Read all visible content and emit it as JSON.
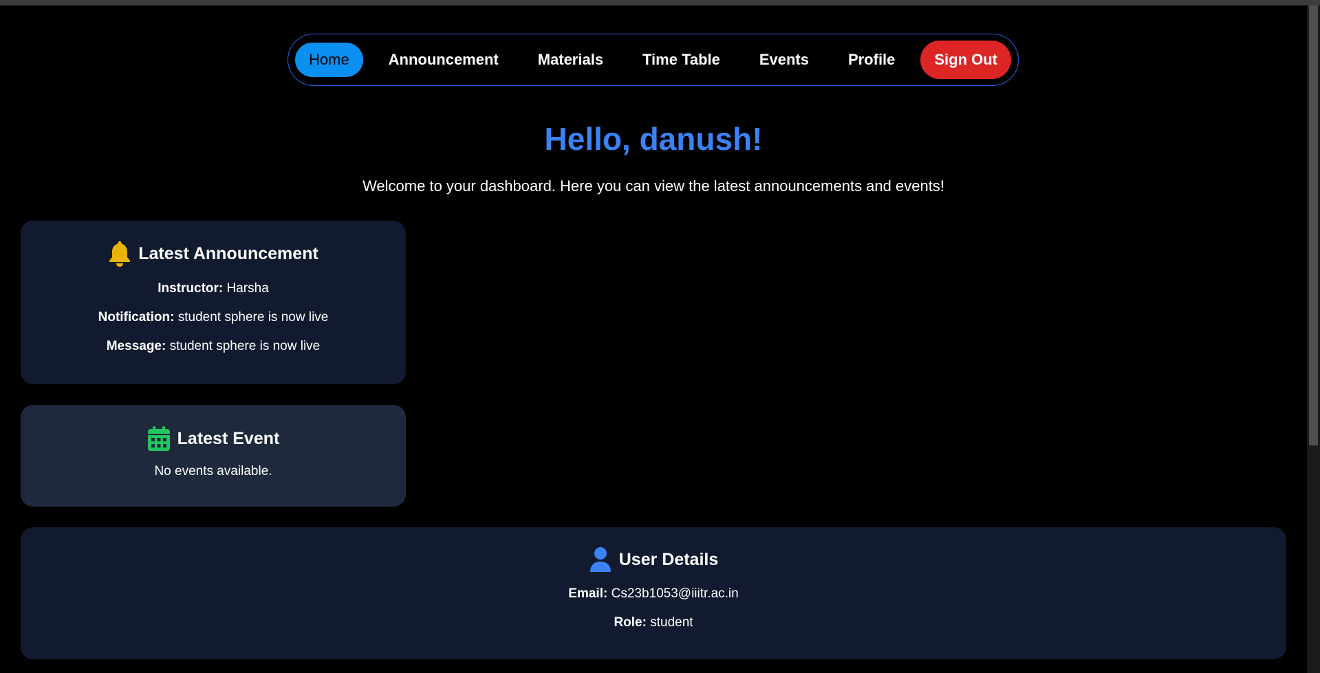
{
  "nav": {
    "items": [
      {
        "label": "Home",
        "active": true
      },
      {
        "label": "Announcement",
        "active": false
      },
      {
        "label": "Materials",
        "active": false
      },
      {
        "label": "Time Table",
        "active": false
      },
      {
        "label": "Events",
        "active": false
      },
      {
        "label": "Profile",
        "active": false
      }
    ],
    "signout_label": "Sign Out"
  },
  "greeting": "Hello, danush!",
  "welcome": "Welcome to your dashboard. Here you can view the latest announcements and events!",
  "announcement": {
    "title": "Latest Announcement",
    "icon": "bell-icon",
    "instructor_label": "Instructor:",
    "instructor": "Harsha",
    "notification_label": "Notification:",
    "notification": "student sphere is now live",
    "message_label": "Message:",
    "message": "student sphere is now live"
  },
  "event": {
    "title": "Latest Event",
    "icon": "calendar-icon",
    "empty_text": "No events available."
  },
  "user": {
    "title": "User Details",
    "icon": "user-icon",
    "email_label": "Email:",
    "email": "Cs23b1053@iiitr.ac.in",
    "role_label": "Role:",
    "role": "student"
  },
  "colors": {
    "accent": "#3b82f6",
    "nav_active": "#0b8ff0",
    "signout": "#dc2626",
    "bell": "#eab308",
    "calendar": "#22c55e",
    "user_icon": "#3b82f6",
    "card_dark": "#111a2e",
    "card_event": "#1e293b"
  }
}
